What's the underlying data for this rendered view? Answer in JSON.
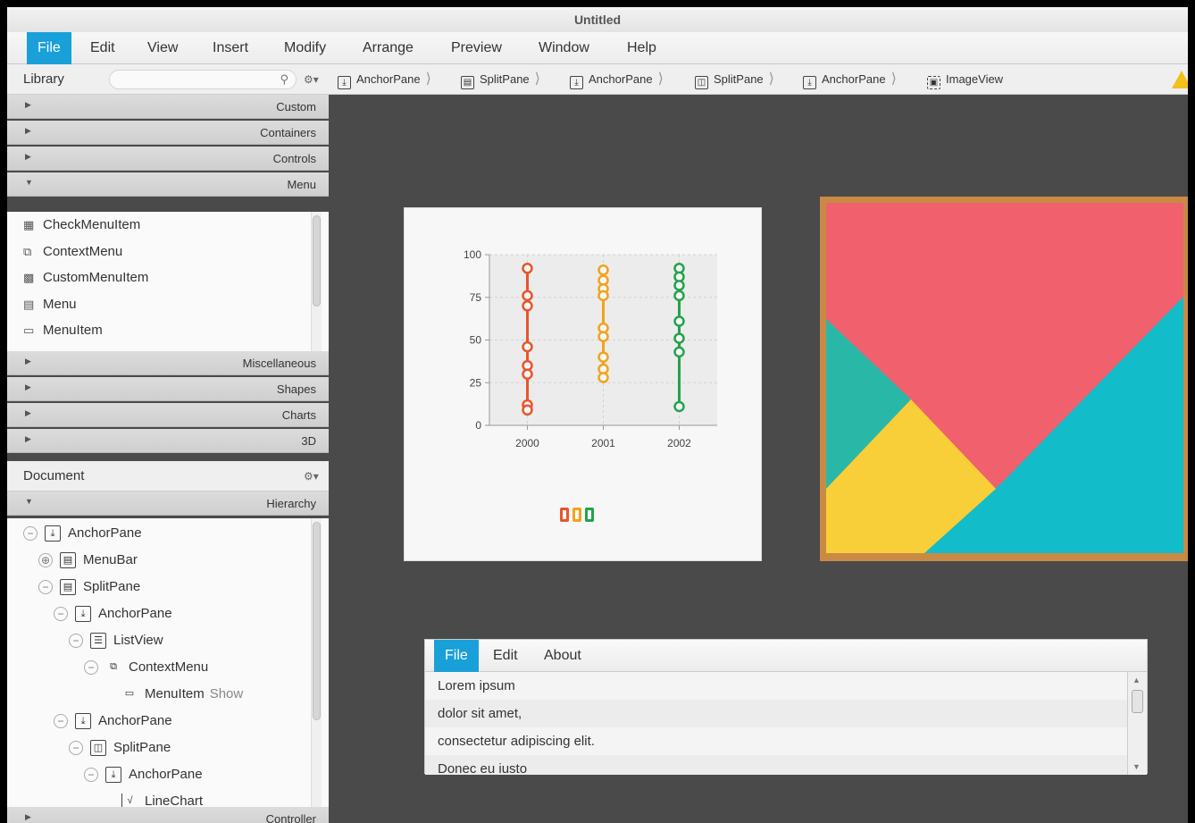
{
  "window": {
    "title": "Untitled"
  },
  "menubar": [
    "File",
    "Edit",
    "View",
    "Insert",
    "Modify",
    "Arrange",
    "Preview",
    "Window",
    "Help"
  ],
  "library": {
    "title": "Library",
    "sections": [
      "Custom",
      "Containers",
      "Controls",
      "Menu"
    ],
    "menu_items": [
      "CheckMenuItem",
      "ContextMenu",
      "CustomMenuItem",
      "Menu",
      "MenuItem"
    ],
    "sections_after": [
      "Miscellaneous",
      "Shapes",
      "Charts",
      "3D"
    ]
  },
  "document": {
    "title": "Document",
    "section": "Hierarchy",
    "footer_section": "Controller",
    "tree": [
      {
        "label": "AnchorPane",
        "hint": ""
      },
      {
        "label": "MenuBar",
        "hint": ""
      },
      {
        "label": "SplitPane",
        "hint": ""
      },
      {
        "label": "AnchorPane",
        "hint": ""
      },
      {
        "label": "ListView",
        "hint": ""
      },
      {
        "label": "ContextMenu",
        "hint": ""
      },
      {
        "label": "MenuItem",
        "hint": "Show"
      },
      {
        "label": "AnchorPane",
        "hint": ""
      },
      {
        "label": "SplitPane",
        "hint": ""
      },
      {
        "label": "AnchorPane",
        "hint": ""
      },
      {
        "label": "LineChart",
        "hint": ""
      }
    ]
  },
  "breadcrumb": [
    "AnchorPane",
    "SplitPane",
    "AnchorPane",
    "SplitPane",
    "AnchorPane",
    "ImageView"
  ],
  "preview_menu": [
    "File",
    "Edit",
    "About"
  ],
  "preview_list": [
    "Lorem ipsum",
    "dolor sit amet,",
    "consectetur adipiscing elit.",
    "Donec eu iusto"
  ],
  "chart_data": {
    "type": "line",
    "categories": [
      "2000",
      "2001",
      "2002"
    ],
    "ylim": [
      0,
      100
    ],
    "yticks": [
      0,
      25,
      50,
      75,
      100
    ],
    "series": [
      {
        "color": "#e8552b",
        "x": "2000",
        "values": [
          92,
          76,
          70,
          46,
          35,
          30,
          12,
          9
        ]
      },
      {
        "color": "#f2a31b",
        "x": "2001",
        "values": [
          91,
          85,
          80,
          76,
          57,
          52,
          40,
          33,
          28
        ]
      },
      {
        "color": "#22a34b",
        "x": "2002",
        "values": [
          92,
          87,
          82,
          76,
          61,
          51,
          43,
          11
        ]
      }
    ]
  },
  "colors": {
    "accent": "#1aa0d8",
    "canvas": "#4a4a4a"
  }
}
